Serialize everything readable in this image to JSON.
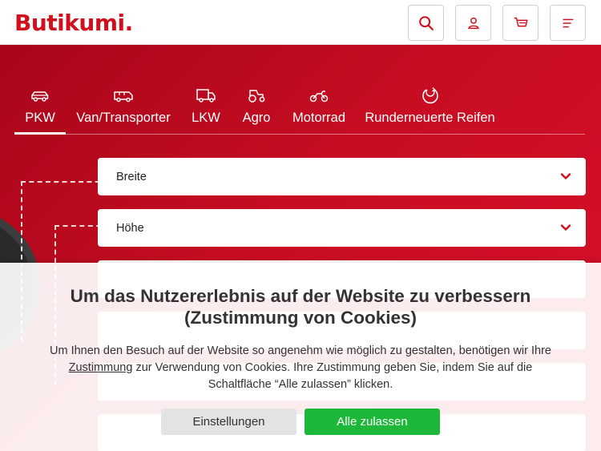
{
  "header": {
    "logo": "Butikumi.",
    "icons": [
      "search-icon",
      "user-icon",
      "cart-icon",
      "menu-icon"
    ]
  },
  "tabs": [
    {
      "label": "PKW",
      "icon": "car-icon",
      "active": true
    },
    {
      "label": "Van/Transporter",
      "icon": "van-icon",
      "active": false
    },
    {
      "label": "LKW",
      "icon": "truck-icon",
      "active": false
    },
    {
      "label": "Agro",
      "icon": "tractor-icon",
      "active": false
    },
    {
      "label": "Motorrad",
      "icon": "motorcycle-icon",
      "active": false
    },
    {
      "label": "Runderneuerte Reifen",
      "icon": "retread-tire-icon",
      "active": false
    }
  ],
  "form": {
    "width_label": "Breite",
    "height_label": "Höhe"
  },
  "cookie": {
    "title_line1": "Um das Nutzererlebnis auf der Website zu verbessern",
    "title_line2": "(Zustimmung von Cookies)",
    "text_part1": "Um Ihnen den Besuch auf der Website so angenehm wie möglich zu gestalten, benötigen wir Ihre",
    "text_link": "Zustimmung",
    "text_part2": "zur Verwendung von Cookies. Ihre Zustimmung geben Sie, indem Sie auf die Schaltfläche “Alle zulassen” klicken.",
    "settings_label": "Einstellungen",
    "accept_label": "Alle zulassen"
  },
  "colors": {
    "brand_red": "#d0101c",
    "accept_green": "#1db83a"
  }
}
